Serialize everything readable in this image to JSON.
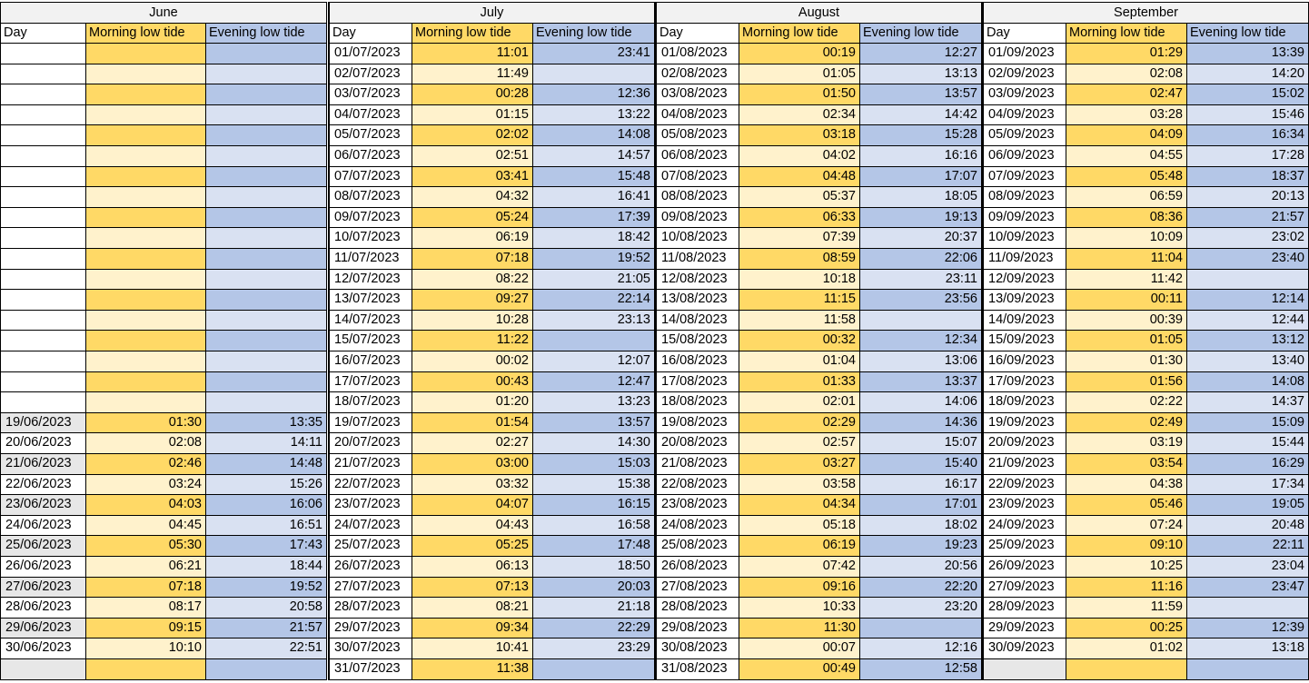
{
  "header_labels": {
    "day": "Day",
    "morning": "Morning low tide",
    "evening": "Evening low tide"
  },
  "months": [
    {
      "name": "June",
      "rows": [
        {
          "day": "",
          "morning": "",
          "evening": ""
        },
        {
          "day": "",
          "morning": "",
          "evening": ""
        },
        {
          "day": "",
          "morning": "",
          "evening": ""
        },
        {
          "day": "",
          "morning": "",
          "evening": ""
        },
        {
          "day": "",
          "morning": "",
          "evening": ""
        },
        {
          "day": "",
          "morning": "",
          "evening": ""
        },
        {
          "day": "",
          "morning": "",
          "evening": ""
        },
        {
          "day": "",
          "morning": "",
          "evening": ""
        },
        {
          "day": "",
          "morning": "",
          "evening": ""
        },
        {
          "day": "",
          "morning": "",
          "evening": ""
        },
        {
          "day": "",
          "morning": "",
          "evening": ""
        },
        {
          "day": "",
          "morning": "",
          "evening": ""
        },
        {
          "day": "",
          "morning": "",
          "evening": ""
        },
        {
          "day": "",
          "morning": "",
          "evening": ""
        },
        {
          "day": "",
          "morning": "",
          "evening": ""
        },
        {
          "day": "",
          "morning": "",
          "evening": ""
        },
        {
          "day": "",
          "morning": "",
          "evening": ""
        },
        {
          "day": "",
          "morning": "",
          "evening": ""
        },
        {
          "day": "19/06/2023",
          "morning": "01:30",
          "evening": "13:35"
        },
        {
          "day": "20/06/2023",
          "morning": "02:08",
          "evening": "14:11"
        },
        {
          "day": "21/06/2023",
          "morning": "02:46",
          "evening": "14:48"
        },
        {
          "day": "22/06/2023",
          "morning": "03:24",
          "evening": "15:26"
        },
        {
          "day": "23/06/2023",
          "morning": "04:03",
          "evening": "16:06"
        },
        {
          "day": "24/06/2023",
          "morning": "04:45",
          "evening": "16:51"
        },
        {
          "day": "25/06/2023",
          "morning": "05:30",
          "evening": "17:43"
        },
        {
          "day": "26/06/2023",
          "morning": "06:21",
          "evening": "18:44"
        },
        {
          "day": "27/06/2023",
          "morning": "07:18",
          "evening": "19:52"
        },
        {
          "day": "28/06/2023",
          "morning": "08:17",
          "evening": "20:58"
        },
        {
          "day": "29/06/2023",
          "morning": "09:15",
          "evening": "21:57"
        },
        {
          "day": "30/06/2023",
          "morning": "10:10",
          "evening": "22:51"
        },
        {
          "day": "",
          "morning": "",
          "evening": ""
        }
      ]
    },
    {
      "name": "July",
      "rows": [
        {
          "day": "01/07/2023",
          "morning": "11:01",
          "evening": "23:41"
        },
        {
          "day": "02/07/2023",
          "morning": "11:49",
          "evening": ""
        },
        {
          "day": "03/07/2023",
          "morning": "00:28",
          "evening": "12:36"
        },
        {
          "day": "04/07/2023",
          "morning": "01:15",
          "evening": "13:22"
        },
        {
          "day": "05/07/2023",
          "morning": "02:02",
          "evening": "14:08"
        },
        {
          "day": "06/07/2023",
          "morning": "02:51",
          "evening": "14:57"
        },
        {
          "day": "07/07/2023",
          "morning": "03:41",
          "evening": "15:48"
        },
        {
          "day": "08/07/2023",
          "morning": "04:32",
          "evening": "16:41"
        },
        {
          "day": "09/07/2023",
          "morning": "05:24",
          "evening": "17:39"
        },
        {
          "day": "10/07/2023",
          "morning": "06:19",
          "evening": "18:42"
        },
        {
          "day": "11/07/2023",
          "morning": "07:18",
          "evening": "19:52"
        },
        {
          "day": "12/07/2023",
          "morning": "08:22",
          "evening": "21:05"
        },
        {
          "day": "13/07/2023",
          "morning": "09:27",
          "evening": "22:14"
        },
        {
          "day": "14/07/2023",
          "morning": "10:28",
          "evening": "23:13"
        },
        {
          "day": "15/07/2023",
          "morning": "11:22",
          "evening": ""
        },
        {
          "day": "16/07/2023",
          "morning": "00:02",
          "evening": "12:07"
        },
        {
          "day": "17/07/2023",
          "morning": "00:43",
          "evening": "12:47"
        },
        {
          "day": "18/07/2023",
          "morning": "01:20",
          "evening": "13:23"
        },
        {
          "day": "19/07/2023",
          "morning": "01:54",
          "evening": "13:57"
        },
        {
          "day": "20/07/2023",
          "morning": "02:27",
          "evening": "14:30"
        },
        {
          "day": "21/07/2023",
          "morning": "03:00",
          "evening": "15:03"
        },
        {
          "day": "22/07/2023",
          "morning": "03:32",
          "evening": "15:38"
        },
        {
          "day": "23/07/2023",
          "morning": "04:07",
          "evening": "16:15"
        },
        {
          "day": "24/07/2023",
          "morning": "04:43",
          "evening": "16:58"
        },
        {
          "day": "25/07/2023",
          "morning": "05:25",
          "evening": "17:48"
        },
        {
          "day": "26/07/2023",
          "morning": "06:13",
          "evening": "18:50"
        },
        {
          "day": "27/07/2023",
          "morning": "07:13",
          "evening": "20:03"
        },
        {
          "day": "28/07/2023",
          "morning": "08:21",
          "evening": "21:18"
        },
        {
          "day": "29/07/2023",
          "morning": "09:34",
          "evening": "22:29"
        },
        {
          "day": "30/07/2023",
          "morning": "10:41",
          "evening": "23:29"
        },
        {
          "day": "31/07/2023",
          "morning": "11:38",
          "evening": ""
        }
      ]
    },
    {
      "name": "August",
      "rows": [
        {
          "day": "01/08/2023",
          "morning": "00:19",
          "evening": "12:27"
        },
        {
          "day": "02/08/2023",
          "morning": "01:05",
          "evening": "13:13"
        },
        {
          "day": "03/08/2023",
          "morning": "01:50",
          "evening": "13:57"
        },
        {
          "day": "04/08/2023",
          "morning": "02:34",
          "evening": "14:42"
        },
        {
          "day": "05/08/2023",
          "morning": "03:18",
          "evening": "15:28"
        },
        {
          "day": "06/08/2023",
          "morning": "04:02",
          "evening": "16:16"
        },
        {
          "day": "07/08/2023",
          "morning": "04:48",
          "evening": "17:07"
        },
        {
          "day": "08/08/2023",
          "morning": "05:37",
          "evening": "18:05"
        },
        {
          "day": "09/08/2023",
          "morning": "06:33",
          "evening": "19:13"
        },
        {
          "day": "10/08/2023",
          "morning": "07:39",
          "evening": "20:37"
        },
        {
          "day": "11/08/2023",
          "morning": "08:59",
          "evening": "22:06"
        },
        {
          "day": "12/08/2023",
          "morning": "10:18",
          "evening": "23:11"
        },
        {
          "day": "13/08/2023",
          "morning": "11:15",
          "evening": "23:56"
        },
        {
          "day": "14/08/2023",
          "morning": "11:58",
          "evening": ""
        },
        {
          "day": "15/08/2023",
          "morning": "00:32",
          "evening": "12:34"
        },
        {
          "day": "16/08/2023",
          "morning": "01:04",
          "evening": "13:06"
        },
        {
          "day": "17/08/2023",
          "morning": "01:33",
          "evening": "13:37"
        },
        {
          "day": "18/08/2023",
          "morning": "02:01",
          "evening": "14:06"
        },
        {
          "day": "19/08/2023",
          "morning": "02:29",
          "evening": "14:36"
        },
        {
          "day": "20/08/2023",
          "morning": "02:57",
          "evening": "15:07"
        },
        {
          "day": "21/08/2023",
          "morning": "03:27",
          "evening": "15:40"
        },
        {
          "day": "22/08/2023",
          "morning": "03:58",
          "evening": "16:17"
        },
        {
          "day": "23/08/2023",
          "morning": "04:34",
          "evening": "17:01"
        },
        {
          "day": "24/08/2023",
          "morning": "05:18",
          "evening": "18:02"
        },
        {
          "day": "25/08/2023",
          "morning": "06:19",
          "evening": "19:23"
        },
        {
          "day": "26/08/2023",
          "morning": "07:42",
          "evening": "20:56"
        },
        {
          "day": "27/08/2023",
          "morning": "09:16",
          "evening": "22:20"
        },
        {
          "day": "28/08/2023",
          "morning": "10:33",
          "evening": "23:20"
        },
        {
          "day": "29/08/2023",
          "morning": "11:30",
          "evening": ""
        },
        {
          "day": "30/08/2023",
          "morning": "00:07",
          "evening": "12:16"
        },
        {
          "day": "31/08/2023",
          "morning": "00:49",
          "evening": "12:58"
        }
      ]
    },
    {
      "name": "September",
      "rows": [
        {
          "day": "01/09/2023",
          "morning": "01:29",
          "evening": "13:39"
        },
        {
          "day": "02/09/2023",
          "morning": "02:08",
          "evening": "14:20"
        },
        {
          "day": "03/09/2023",
          "morning": "02:47",
          "evening": "15:02"
        },
        {
          "day": "04/09/2023",
          "morning": "03:28",
          "evening": "15:46"
        },
        {
          "day": "05/09/2023",
          "morning": "04:09",
          "evening": "16:34"
        },
        {
          "day": "06/09/2023",
          "morning": "04:55",
          "evening": "17:28"
        },
        {
          "day": "07/09/2023",
          "morning": "05:48",
          "evening": "18:37"
        },
        {
          "day": "08/09/2023",
          "morning": "06:59",
          "evening": "20:13"
        },
        {
          "day": "09/09/2023",
          "morning": "08:36",
          "evening": "21:57"
        },
        {
          "day": "10/09/2023",
          "morning": "10:09",
          "evening": "23:02"
        },
        {
          "day": "11/09/2023",
          "morning": "11:04",
          "evening": "23:40"
        },
        {
          "day": "12/09/2023",
          "morning": "11:42",
          "evening": ""
        },
        {
          "day": "13/09/2023",
          "morning": "00:11",
          "evening": "12:14"
        },
        {
          "day": "14/09/2023",
          "morning": "00:39",
          "evening": "12:44"
        },
        {
          "day": "15/09/2023",
          "morning": "01:05",
          "evening": "13:12"
        },
        {
          "day": "16/09/2023",
          "morning": "01:30",
          "evening": "13:40"
        },
        {
          "day": "17/09/2023",
          "morning": "01:56",
          "evening": "14:08"
        },
        {
          "day": "18/09/2023",
          "morning": "02:22",
          "evening": "14:37"
        },
        {
          "day": "19/09/2023",
          "morning": "02:49",
          "evening": "15:09"
        },
        {
          "day": "20/09/2023",
          "morning": "03:19",
          "evening": "15:44"
        },
        {
          "day": "21/09/2023",
          "morning": "03:54",
          "evening": "16:29"
        },
        {
          "day": "22/09/2023",
          "morning": "04:38",
          "evening": "17:34"
        },
        {
          "day": "23/09/2023",
          "morning": "05:46",
          "evening": "19:05"
        },
        {
          "day": "24/09/2023",
          "morning": "07:24",
          "evening": "20:48"
        },
        {
          "day": "25/09/2023",
          "morning": "09:10",
          "evening": "22:11"
        },
        {
          "day": "26/09/2023",
          "morning": "10:25",
          "evening": "23:04"
        },
        {
          "day": "27/09/2023",
          "morning": "11:16",
          "evening": "23:47"
        },
        {
          "day": "28/09/2023",
          "morning": "11:59",
          "evening": ""
        },
        {
          "day": "29/09/2023",
          "morning": "00:25",
          "evening": "12:39"
        },
        {
          "day": "30/09/2023",
          "morning": "01:02",
          "evening": "13:18"
        },
        {
          "day": "",
          "morning": "",
          "evening": ""
        }
      ]
    }
  ],
  "colors": {
    "morning_dark": "#ffd966",
    "morning_light": "#fff2cc",
    "evening_dark": "#b4c6e7",
    "evening_light": "#d9e1f2",
    "month_header_bg": "#f2f2f2",
    "grid_line": "#000000"
  }
}
